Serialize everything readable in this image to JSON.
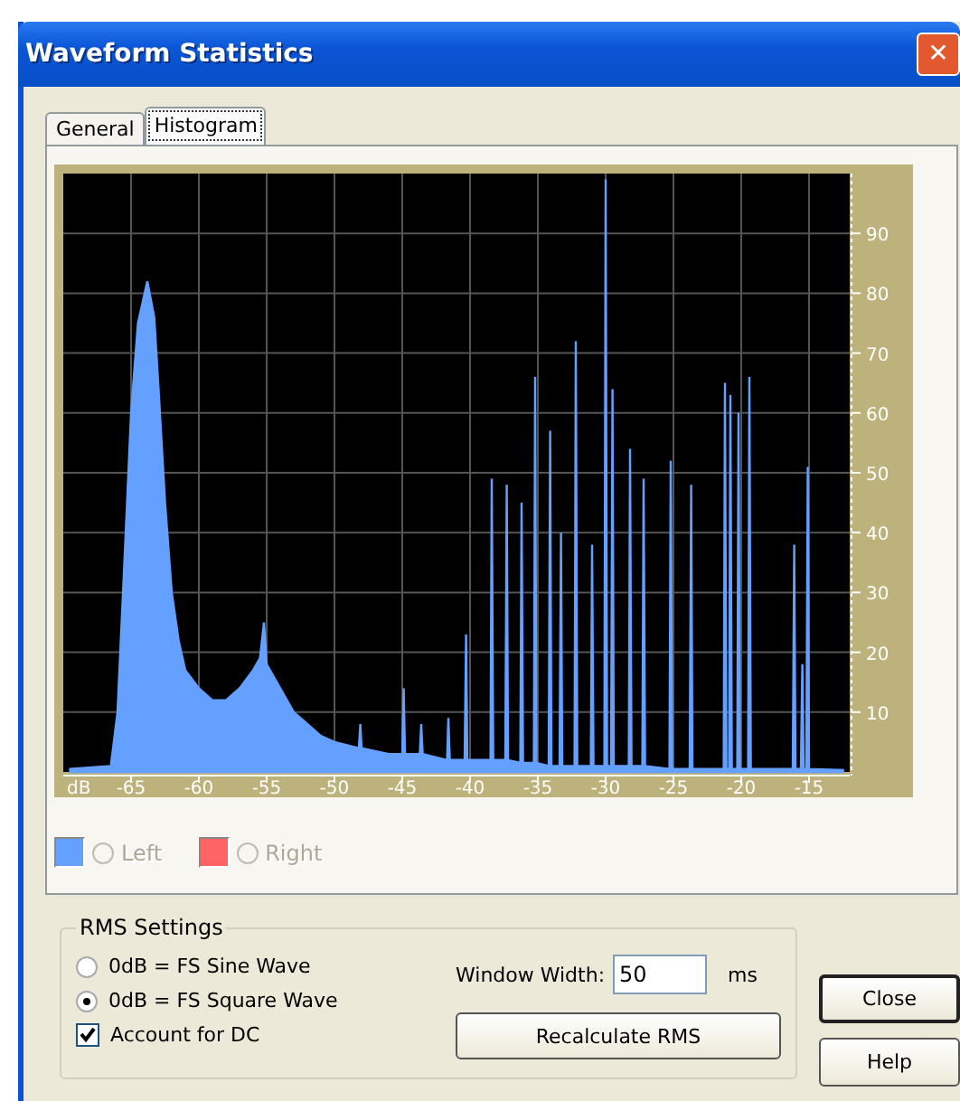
{
  "window": {
    "title": "Waveform Statistics",
    "close_icon": "✕"
  },
  "tabs": [
    {
      "label": "General",
      "selected": false
    },
    {
      "label": "Histogram",
      "selected": true
    }
  ],
  "histogram": {
    "chart_data": {
      "type": "area",
      "grid": true,
      "xlabel": "dB",
      "xlim": [
        -70,
        -12
      ],
      "ylim": [
        0,
        100
      ],
      "xticks": [
        -65,
        -60,
        -55,
        -50,
        -45,
        -40,
        -35,
        -30,
        -25,
        -20,
        -15
      ],
      "yticks": [
        10,
        20,
        30,
        40,
        50,
        60,
        70,
        80,
        90
      ],
      "x": [
        -69.5,
        -66.5,
        -66,
        -65.5,
        -65,
        -64.5,
        -64,
        -63.8,
        -63.3,
        -63,
        -62.5,
        -62,
        -61.5,
        -61,
        -60,
        -59,
        -58,
        -57,
        -56,
        -55.5,
        -55.2,
        -55,
        -54,
        -53,
        -52,
        -51,
        -50,
        -48.2,
        -48.1,
        -48,
        -46,
        -45,
        -44.9,
        -44.8,
        -43.7,
        -43.6,
        -43.5,
        -41.7,
        -41.6,
        -41.5,
        -40.4,
        -40.3,
        -40.2,
        -38.5,
        -38.4,
        -38.3,
        -37.4,
        -37.3,
        -37.2,
        -36.3,
        -36.2,
        -36.1,
        -35.3,
        -35.2,
        -35.1,
        -34.2,
        -34.1,
        -34,
        -33.4,
        -33.3,
        -33.2,
        -32.3,
        -32.2,
        -32.1,
        -31.1,
        -31,
        -30.9,
        -30.1,
        -30,
        -29.9,
        -29.6,
        -29.5,
        -29.4,
        -28.3,
        -28.2,
        -28.1,
        -27.3,
        -27.2,
        -27.1,
        -25.3,
        -25.2,
        -25.1,
        -23.8,
        -23.7,
        -23.6,
        -21.3,
        -21.2,
        -21.1,
        -20.9,
        -20.8,
        -20.7,
        -20.3,
        -20.2,
        -20.1,
        -19.5,
        -19.4,
        -19.3,
        -16.2,
        -16.1,
        -16,
        -15.6,
        -15.5,
        -15.4,
        -15.2,
        -15.1,
        -15,
        -12.5
      ],
      "series": [
        {
          "color": "#64a0ff",
          "values": [
            0.5,
            1,
            10,
            35,
            60,
            75,
            80,
            82,
            76,
            65,
            45,
            30,
            22,
            17,
            14,
            12,
            12,
            14,
            17,
            19,
            25,
            18,
            14,
            10,
            8,
            6,
            5,
            4,
            8,
            4,
            3,
            3,
            14,
            3,
            3,
            8,
            3,
            2,
            9,
            2,
            2,
            23,
            2,
            2,
            49,
            2,
            2,
            48,
            2,
            1.5,
            45,
            1.5,
            1.5,
            66,
            1.5,
            1,
            57,
            1,
            1,
            40,
            1,
            1,
            72,
            1,
            1,
            38,
            1,
            1,
            99,
            1,
            1,
            64,
            1,
            1,
            54,
            1,
            1,
            49,
            1,
            0.5,
            52,
            0.5,
            0.5,
            48,
            0.5,
            0.5,
            65,
            0.5,
            0.5,
            63,
            0.5,
            0.5,
            60,
            0.5,
            0.5,
            66,
            0.5,
            0.5,
            38,
            0.5,
            0.5,
            18,
            0.5,
            0.5,
            51,
            0.5,
            0.3
          ]
        }
      ]
    }
  },
  "legend": [
    {
      "label": "Left",
      "color": "#64a0ff",
      "selected": false,
      "disabled": true
    },
    {
      "label": "Right",
      "color": "#ff6464",
      "selected": false,
      "disabled": true
    }
  ],
  "rms_settings": {
    "title": "RMS Settings",
    "options": [
      {
        "label": "0dB = FS Sine Wave",
        "selected": false
      },
      {
        "label": "0dB = FS Square Wave",
        "selected": true
      }
    ],
    "account_for_dc": {
      "label": "Account for DC",
      "checked": true
    },
    "window_width": {
      "label": "Window Width:",
      "value": "50",
      "unit": "ms"
    },
    "recalculate_button": "Recalculate RMS"
  },
  "buttons": [
    "Close",
    "Help"
  ]
}
